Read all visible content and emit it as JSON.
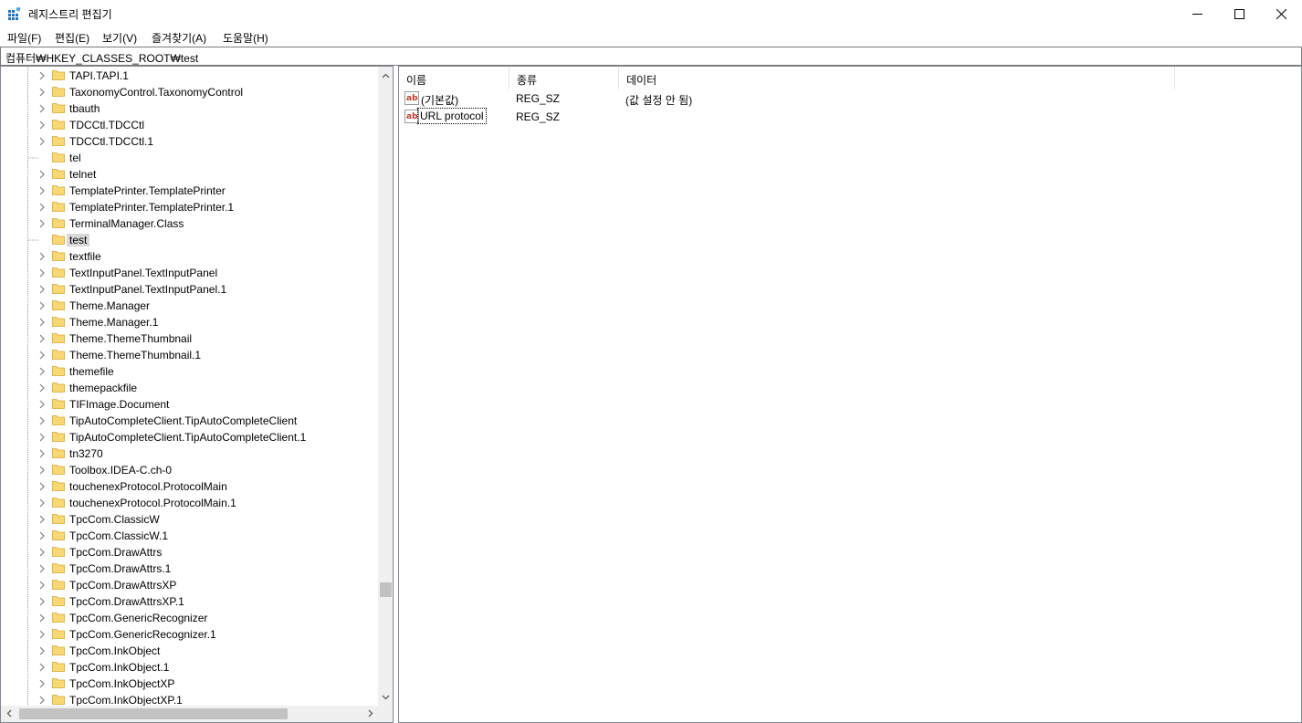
{
  "window": {
    "title": "레지스트리 편집기",
    "controls": [
      "minimize",
      "maximize",
      "close"
    ]
  },
  "menu": [
    "파일(F)",
    "편집(E)",
    "보기(V)",
    "즐겨찾기(A)",
    "도움말(H)"
  ],
  "address": "컴퓨터₩HKEY_CLASSES_ROOT₩test",
  "tree": {
    "items": [
      {
        "label": "TAPI.TAPI.1",
        "expandable": true
      },
      {
        "label": "TaxonomyControl.TaxonomyControl",
        "expandable": true
      },
      {
        "label": "tbauth",
        "expandable": true
      },
      {
        "label": "TDCCtl.TDCCtl",
        "expandable": true
      },
      {
        "label": "TDCCtl.TDCCtl.1",
        "expandable": true
      },
      {
        "label": "tel",
        "expandable": false
      },
      {
        "label": "telnet",
        "expandable": true
      },
      {
        "label": "TemplatePrinter.TemplatePrinter",
        "expandable": true
      },
      {
        "label": "TemplatePrinter.TemplatePrinter.1",
        "expandable": true
      },
      {
        "label": "TerminalManager.Class",
        "expandable": true
      },
      {
        "label": "test",
        "expandable": false,
        "selected": true
      },
      {
        "label": "textfile",
        "expandable": true
      },
      {
        "label": "TextInputPanel.TextInputPanel",
        "expandable": true
      },
      {
        "label": "TextInputPanel.TextInputPanel.1",
        "expandable": true
      },
      {
        "label": "Theme.Manager",
        "expandable": true
      },
      {
        "label": "Theme.Manager.1",
        "expandable": true
      },
      {
        "label": "Theme.ThemeThumbnail",
        "expandable": true
      },
      {
        "label": "Theme.ThemeThumbnail.1",
        "expandable": true
      },
      {
        "label": "themefile",
        "expandable": true
      },
      {
        "label": "themepackfile",
        "expandable": true
      },
      {
        "label": "TIFImage.Document",
        "expandable": true
      },
      {
        "label": "TipAutoCompleteClient.TipAutoCompleteClient",
        "expandable": true
      },
      {
        "label": "TipAutoCompleteClient.TipAutoCompleteClient.1",
        "expandable": true
      },
      {
        "label": "tn3270",
        "expandable": true
      },
      {
        "label": "Toolbox.IDEA-C.ch-0",
        "expandable": true
      },
      {
        "label": "touchenexProtocol.ProtocolMain",
        "expandable": true
      },
      {
        "label": "touchenexProtocol.ProtocolMain.1",
        "expandable": true
      },
      {
        "label": "TpcCom.ClassicW",
        "expandable": true
      },
      {
        "label": "TpcCom.ClassicW.1",
        "expandable": true
      },
      {
        "label": "TpcCom.DrawAttrs",
        "expandable": true
      },
      {
        "label": "TpcCom.DrawAttrs.1",
        "expandable": true
      },
      {
        "label": "TpcCom.DrawAttrsXP",
        "expandable": true
      },
      {
        "label": "TpcCom.DrawAttrsXP.1",
        "expandable": true
      },
      {
        "label": "TpcCom.GenericRecognizer",
        "expandable": true
      },
      {
        "label": "TpcCom.GenericRecognizer.1",
        "expandable": true
      },
      {
        "label": "TpcCom.InkObject",
        "expandable": true
      },
      {
        "label": "TpcCom.InkObject.1",
        "expandable": true
      },
      {
        "label": "TpcCom.InkObjectXP",
        "expandable": true
      },
      {
        "label": "TpcCom.InkObjectXP.1",
        "expandable": true
      }
    ]
  },
  "list": {
    "columns": [
      "이름",
      "종류",
      "데이터"
    ],
    "rows": [
      {
        "name": "(기본값)",
        "type": "REG_SZ",
        "data": "(값 설정 안 됨)",
        "icon": "string-value-icon"
      },
      {
        "name": "URL protocol",
        "type": "REG_SZ",
        "data": "",
        "icon": "string-value-icon",
        "focused": true
      }
    ]
  },
  "colors": {
    "selection": "#d9d9d9",
    "folder": "#f8d775",
    "border": "#828790"
  }
}
